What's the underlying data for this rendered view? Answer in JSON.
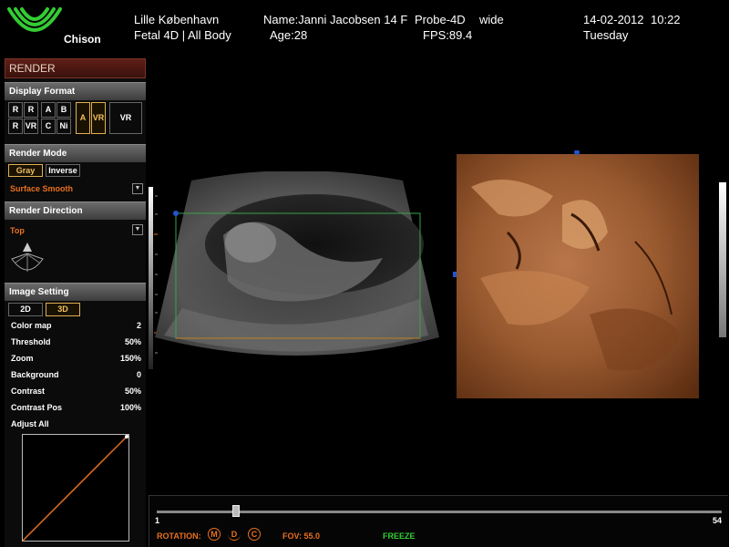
{
  "header": {
    "brand": "Chison",
    "hospital": "Lille København",
    "patient_name": "Name:Janni Jacobsen 14 F",
    "probe": "Probe-4D",
    "probe_mode": "wide",
    "exam": "Fetal 4D | All Body",
    "age": "Age:28",
    "fps": "FPS:89.4",
    "date": "14-02-2012",
    "time": "10:22",
    "weekday": "Tuesday"
  },
  "panel": {
    "title": "RENDER",
    "display_format": {
      "title": "Display Format",
      "cells": [
        "R",
        "R",
        "A",
        "B",
        "R",
        "VR",
        "C",
        "Ni"
      ],
      "selected_a": "A",
      "selected_vr": "VR",
      "vr_only": "VR"
    },
    "render_mode": {
      "title": "Render Mode",
      "gray": "Gray",
      "inverse": "Inverse",
      "surface": "Surface Smooth"
    },
    "render_direction": {
      "title": "Render Direction",
      "value": "Top"
    },
    "image_setting": {
      "title": "Image Setting",
      "btn_2d": "2D",
      "btn_3d": "3D",
      "rows": [
        {
          "label": "Color map",
          "value": "2"
        },
        {
          "label": "Threshold",
          "value": "50%"
        },
        {
          "label": "Zoom",
          "value": "150%"
        },
        {
          "label": "Background",
          "value": "0"
        },
        {
          "label": "Contrast",
          "value": "50%"
        },
        {
          "label": "Contrast Pos",
          "value": "100%"
        }
      ],
      "adjust_all": "Adjust All"
    }
  },
  "bottom": {
    "slider_min": "1",
    "slider_max": "54",
    "slider_position": 0.14,
    "rotation": "ROTATION:",
    "rot_m": "M",
    "rot_d": "D",
    "rot_c": "C",
    "fov": "FOV: 55.0",
    "freeze": "FREEZE"
  },
  "colors": {
    "accent_orange": "#e87020",
    "freeze_green": "#33cc33",
    "logo_green": "#33cc33",
    "selected_gold": "#e0b050"
  }
}
